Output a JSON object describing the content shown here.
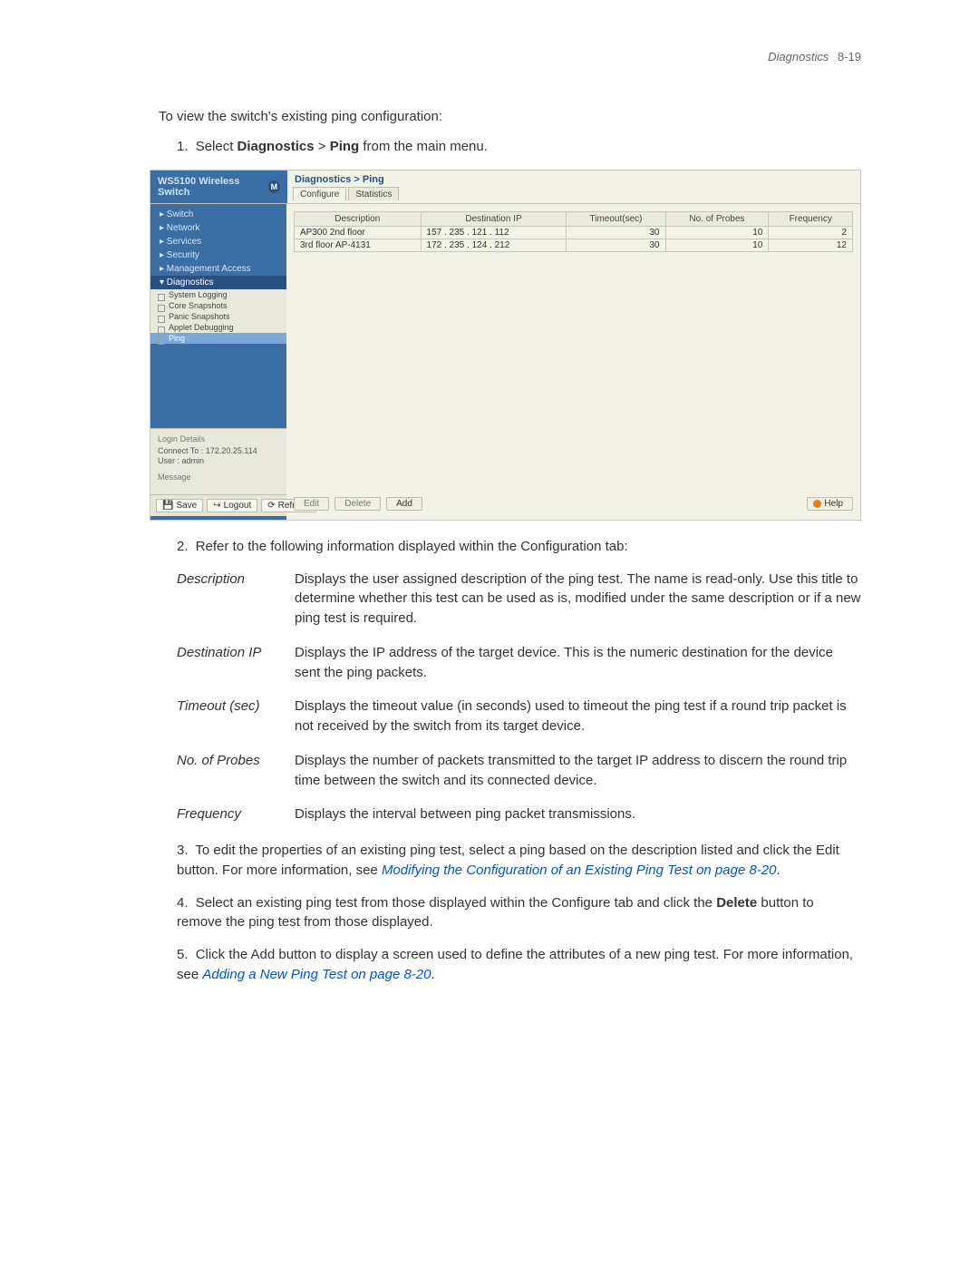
{
  "header": {
    "section": "Diagnostics",
    "page": "8-19"
  },
  "intro": "To view the switch's existing ping configuration:",
  "step1": {
    "num": "1.",
    "pre": "Select ",
    "b1": "Diagnostics",
    "sep": " > ",
    "b2": "Ping",
    "post": " from the main menu."
  },
  "screenshot": {
    "product": "WS5100 Wireless Switch",
    "badge": "M",
    "breadcrumb": "Diagnostics > Ping",
    "tabs": [
      "Configure",
      "Statistics"
    ],
    "nav": [
      "▸ Switch",
      "▸ Network",
      "▸ Services",
      "▸ Security",
      "▸ Management Access",
      "▾ Diagnostics"
    ],
    "subnav": [
      "System Logging",
      "Core Snapshots",
      "Panic Snapshots",
      "Applet Debugging",
      "Ping"
    ],
    "columns": [
      "Description",
      "Destination IP",
      "Timeout(sec)",
      "No. of Probes",
      "Frequency"
    ],
    "rows": [
      {
        "desc": "AP300 2nd floor",
        "ip": "157 . 235 . 121 . 112",
        "timeout": "30",
        "probes": "10",
        "freq": "2"
      },
      {
        "desc": "3rd floor AP-4131",
        "ip": "172 . 235 . 124 . 212",
        "timeout": "30",
        "probes": "10",
        "freq": "12"
      }
    ],
    "login": {
      "title": "Login Details",
      "connect_l": "Connect To :",
      "connect_v": "172.20.25.114",
      "user_l": "User :",
      "user_v": "admin"
    },
    "message_t": "Message",
    "buttons": {
      "edit": "Edit",
      "delete": "Delete",
      "add": "Add",
      "help": "Help"
    },
    "footer": {
      "save": "Save",
      "logout": "Logout",
      "refresh": "Refresh"
    }
  },
  "step2": "Refer to the following information displayed within the Configuration tab:",
  "defs": [
    {
      "t": "Description",
      "d": "Displays the user assigned description of the ping test. The name is read-only. Use this title to determine whether this test can be used as is, modified under the same description or if a new ping test is required."
    },
    {
      "t": "Destination IP",
      "d": "Displays the IP address of the target device. This is the numeric destination for the device sent the ping packets."
    },
    {
      "t": "Timeout (sec)",
      "d": "Displays the timeout value (in seconds) used to timeout the ping test if a round trip packet is not received by the switch from its target device."
    },
    {
      "t": "No. of Probes",
      "d": "Displays the number of packets transmitted to the target IP address to discern the round trip time between the switch and its connected device."
    },
    {
      "t": "Frequency",
      "d": "Displays the interval between ping packet transmissions."
    }
  ],
  "step3": {
    "num": "3.",
    "pre": "To edit the properties of an existing ping test, select a ping based on the description listed and click the Edit button. For more information, see ",
    "link": "Modifying the Configuration of an Existing Ping Test on page 8-20",
    "post": "."
  },
  "step4": {
    "num": "4.",
    "pre": "Select an existing ping test from those displayed within the Configure tab and click the ",
    "b": "Delete",
    "post": " button to remove the ping test from those displayed."
  },
  "step5": {
    "num": "5.",
    "pre": "Click the Add button to display a screen used to define the attributes of a new ping test. For more information, see ",
    "link": "Adding a New Ping Test on page 8-20",
    "post": "."
  }
}
